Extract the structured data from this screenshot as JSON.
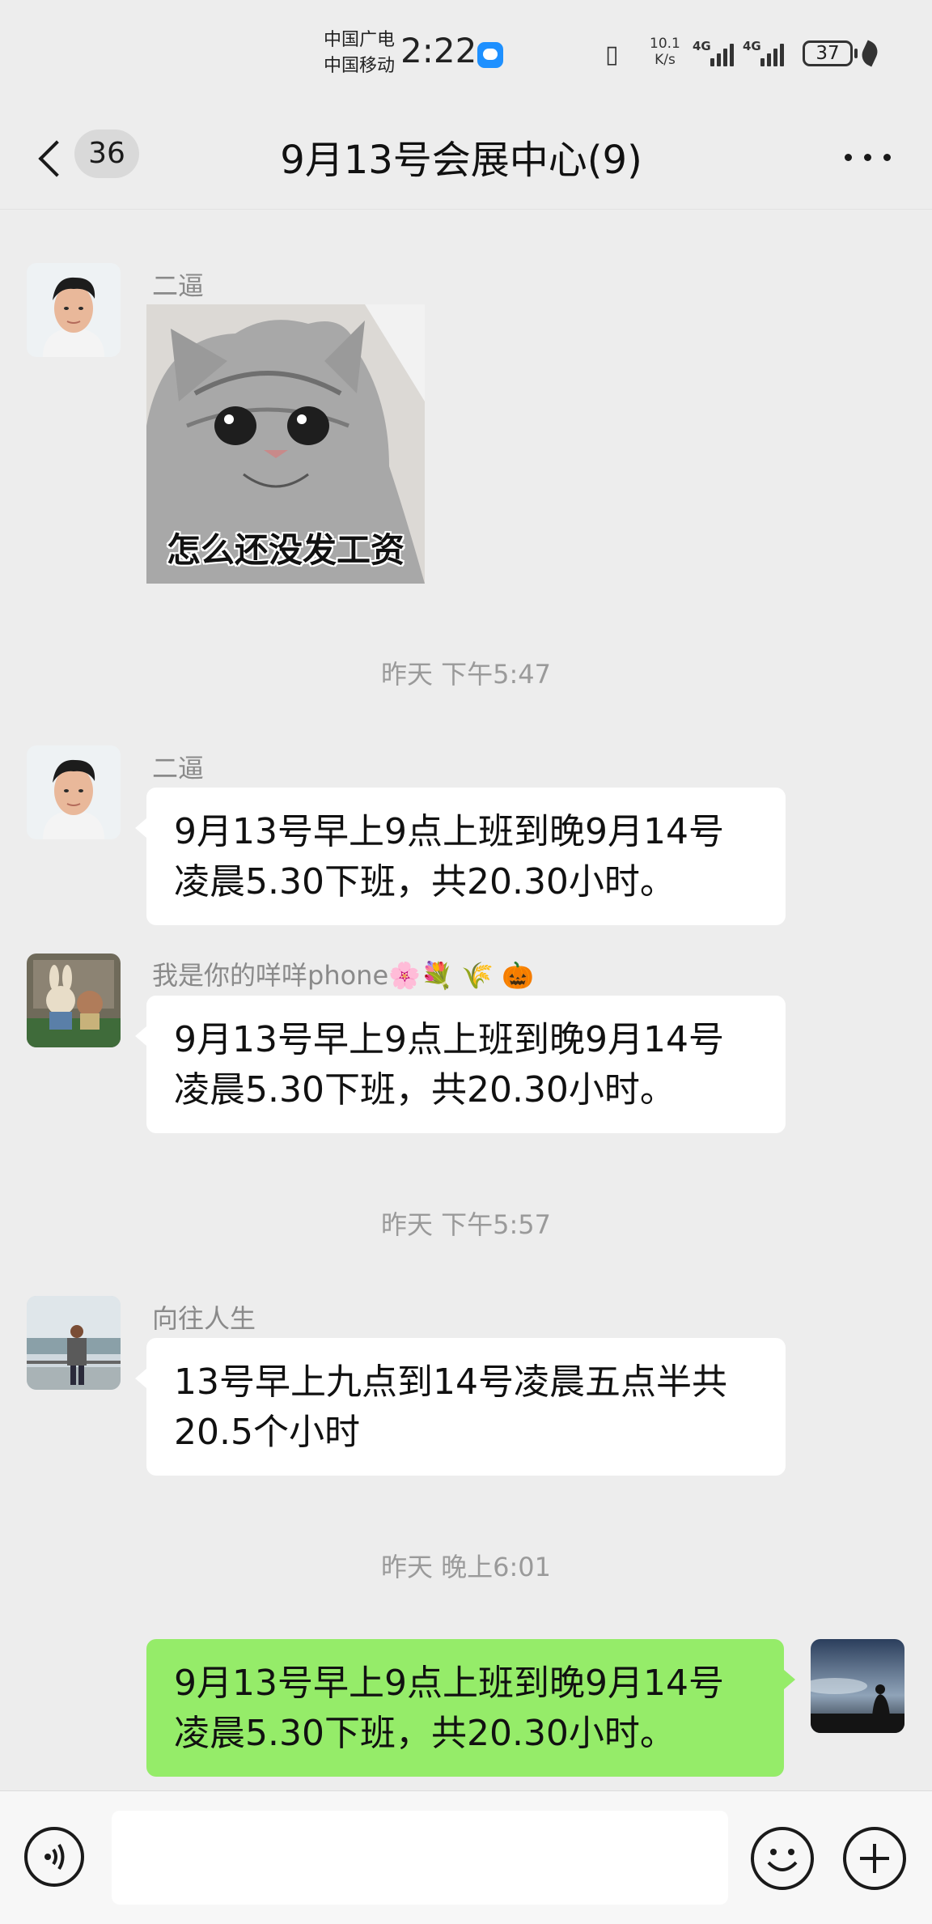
{
  "status_bar": {
    "carrier_1": "中国广电",
    "carrier_2": "中国移动",
    "time": "2:22",
    "net_speed_value": "10.1",
    "net_speed_unit": "K/s",
    "signal_1_type": "4G",
    "signal_2_type": "4G",
    "battery": "37"
  },
  "header": {
    "unread_count": "36",
    "title": "9月13号会展中心(9)"
  },
  "messages": [
    {
      "sender": "二逼",
      "type": "sticker",
      "sticker_caption": "怎么还没发工资"
    },
    {
      "timestamp": "昨天 下午5:47"
    },
    {
      "sender": "二逼",
      "type": "text",
      "text": "9月13号早上9点上班到晚9月14号凌晨5.30下班，共20.30小时。"
    },
    {
      "sender": "我是你的咩咩phone🌸💐 🌾 🎃",
      "type": "text",
      "text": "9月13号早上9点上班到晚9月14号凌晨5.30下班，共20.30小时。"
    },
    {
      "timestamp": "昨天 下午5:57"
    },
    {
      "sender": "向往人生",
      "type": "text",
      "text": "13号早上九点到14号凌晨五点半共20.5个小时"
    },
    {
      "timestamp": "昨天 晚上6:01"
    },
    {
      "sender": "",
      "type": "text",
      "mine": true,
      "text": "9月13号早上9点上班到晚9月14号凌晨5.30下班，共20.30小时。"
    }
  ],
  "input_bar": {
    "placeholder": ""
  },
  "colors": {
    "background": "#ededed",
    "my_bubble": "#95ec69",
    "other_bubble": "#ffffff"
  }
}
